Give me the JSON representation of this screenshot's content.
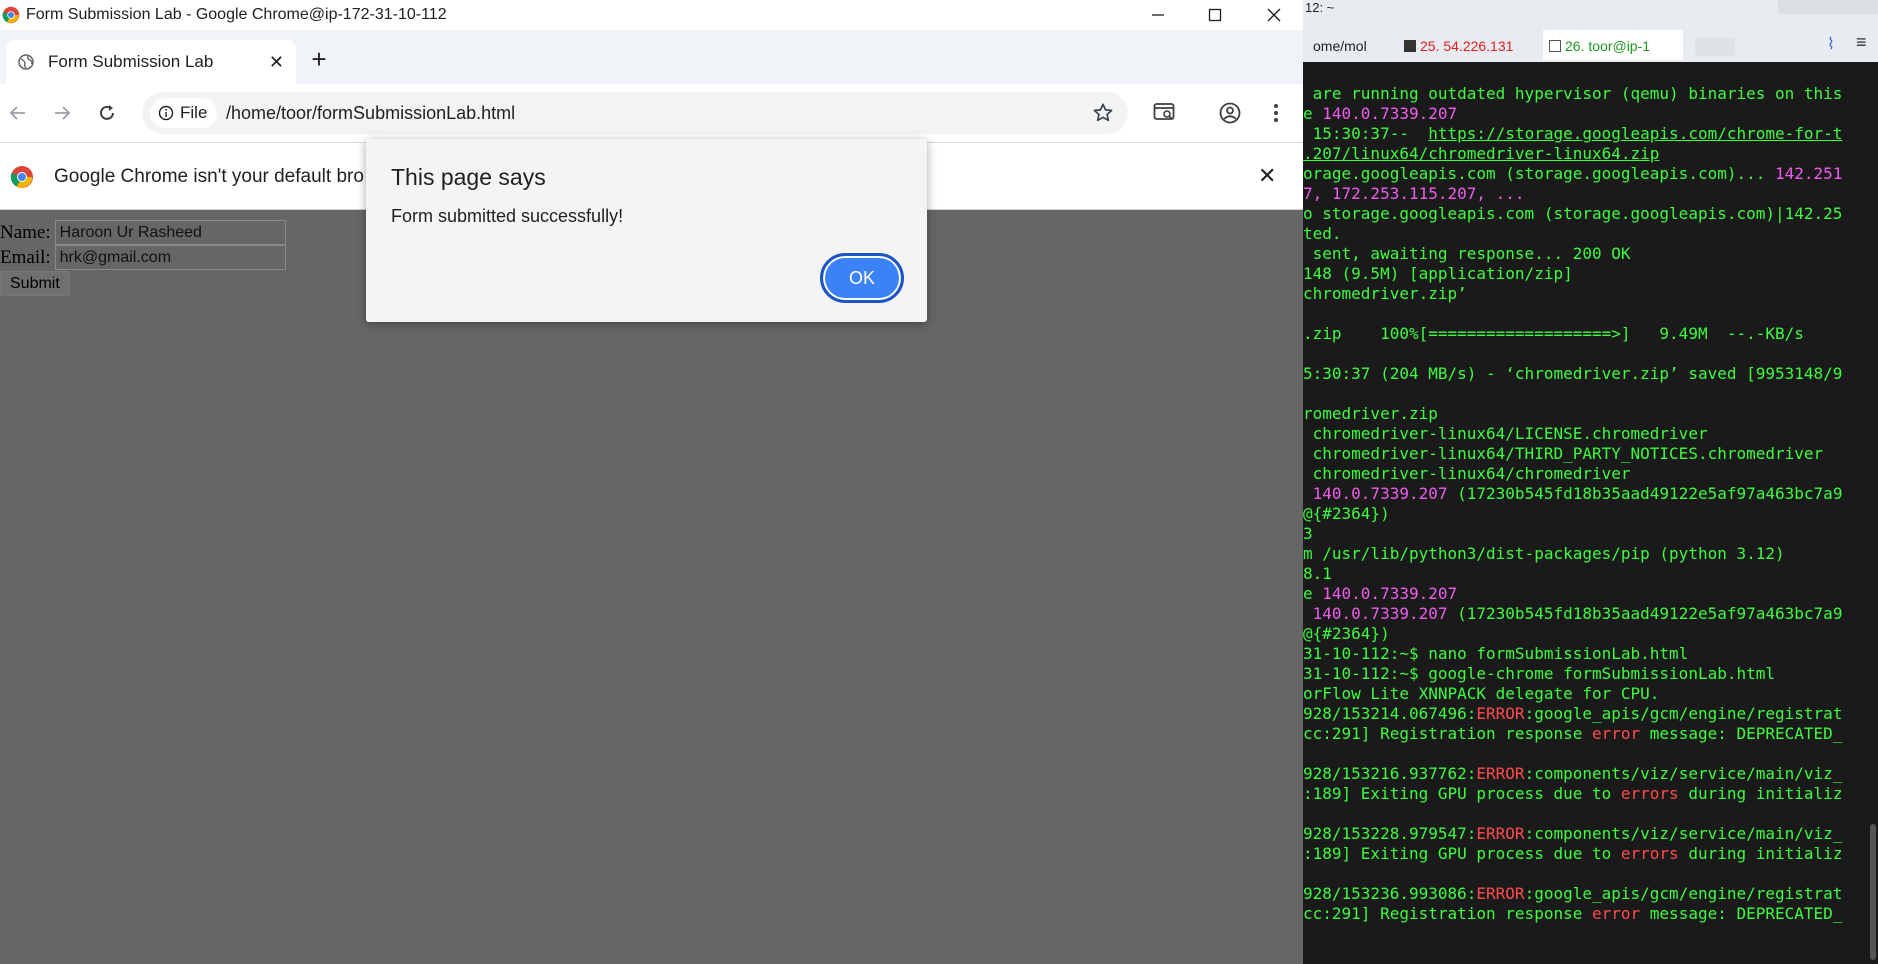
{
  "chrome": {
    "window_title": "Form Submission Lab - Google Chrome@ip-172-31-10-112",
    "tab_title": "Form Submission Lab",
    "new_tab_symbol": "+",
    "site_chip": "File",
    "url": "/home/toor/formSubmissionLab.html",
    "infobar_message": "Google Chrome isn't your default browser",
    "colors": {
      "accent": "#3b82f6",
      "page_overlay": "#666666"
    }
  },
  "page": {
    "name_label": "Name:",
    "name_value": "Haroon Ur Rasheed",
    "email_label": "Email:",
    "email_value": "hrk@gmail.com",
    "submit_label": "Submit"
  },
  "alert": {
    "heading": "This page says",
    "message": "Form submitted successfully!",
    "ok_label": "OK"
  },
  "terminal": {
    "title": "12: ~",
    "tabs": [
      {
        "label": "ome/mol",
        "color": "#222222"
      },
      {
        "label": "25. 54.226.131",
        "color": "#e02020"
      },
      {
        "label": "26. toor@ip-1",
        "color": "#1f9a1f"
      }
    ],
    "lines": [
      [
        {
          "t": " are running outdated hypervisor (qemu) binaries on this"
        }
      ],
      [
        {
          "t": "e "
        },
        {
          "t": "140.0.7339.207",
          "c": "mg"
        }
      ],
      [
        {
          "t": " 15:30:37--  "
        },
        {
          "t": "https://storage.googleapis.com/chrome-for-t",
          "c": "lk"
        }
      ],
      [
        {
          "t": ".207/linux64/chromedriver-linux64.zip",
          "c": "lk"
        }
      ],
      [
        {
          "t": "orage.googleapis.com (storage.googleapis.com)... "
        },
        {
          "t": "142.251",
          "c": "mg"
        }
      ],
      [
        {
          "t": "7, 172.253.115.207, ...",
          "c": "mg"
        }
      ],
      [
        {
          "t": "o storage.googleapis.com (storage.googleapis.com)|142.25"
        }
      ],
      [
        {
          "t": "ted."
        }
      ],
      [
        {
          "t": " sent, awaiting response... 200 OK"
        }
      ],
      [
        {
          "t": "148 (9.5M) [application/zip]"
        }
      ],
      [
        {
          "t": "chromedriver.zip’"
        }
      ],
      [
        {
          "t": ""
        }
      ],
      [
        {
          "t": ".zip    100%[===================>]   9.49M  --.-KB/s"
        }
      ],
      [
        {
          "t": ""
        }
      ],
      [
        {
          "t": "5:30:37 (204 MB/s) - ‘chromedriver.zip’ saved [9953148/9"
        }
      ],
      [
        {
          "t": ""
        }
      ],
      [
        {
          "t": "romedriver.zip"
        }
      ],
      [
        {
          "t": " chromedriver-linux64/LICENSE.chromedriver"
        }
      ],
      [
        {
          "t": " chromedriver-linux64/THIRD_PARTY_NOTICES.chromedriver"
        }
      ],
      [
        {
          "t": " chromedriver-linux64/chromedriver"
        }
      ],
      [
        {
          "t": " 140.0.7339.207",
          "c": "mg"
        },
        {
          "t": " (17230b545fd18b35aad49122e5af97a463bc7a9"
        }
      ],
      [
        {
          "t": "@{#2364})"
        }
      ],
      [
        {
          "t": "3"
        }
      ],
      [
        {
          "t": "m /usr/lib/python3/dist-packages/pip (python 3.12)"
        }
      ],
      [
        {
          "t": "8.1"
        }
      ],
      [
        {
          "t": "e "
        },
        {
          "t": "140.0.7339.207",
          "c": "mg"
        }
      ],
      [
        {
          "t": " 140.0.7339.207",
          "c": "mg"
        },
        {
          "t": " (17230b545fd18b35aad49122e5af97a463bc7a9"
        }
      ],
      [
        {
          "t": "@{#2364})"
        }
      ],
      [
        {
          "t": "31-10-112:~$ nano formSubmissionLab.html"
        }
      ],
      [
        {
          "t": "31-10-112:~$ google-chrome formSubmissionLab.html"
        }
      ],
      [
        {
          "t": "orFlow Lite XNNPACK delegate for CPU."
        }
      ],
      [
        {
          "t": "928/153214.067496:"
        },
        {
          "t": "ERROR",
          "c": "rd"
        },
        {
          "t": ":google_apis/gcm/engine/registrat"
        }
      ],
      [
        {
          "t": "cc:291] Registration response "
        },
        {
          "t": "error",
          "c": "rd"
        },
        {
          "t": " message: DEPRECATED_"
        }
      ],
      [
        {
          "t": ""
        }
      ],
      [
        {
          "t": "928/153216.937762:"
        },
        {
          "t": "ERROR",
          "c": "rd"
        },
        {
          "t": ":components/viz/service/main/viz_"
        }
      ],
      [
        {
          "t": ":189] Exiting GPU process due to "
        },
        {
          "t": "errors",
          "c": "rd"
        },
        {
          "t": " during initializ"
        }
      ],
      [
        {
          "t": ""
        }
      ],
      [
        {
          "t": "928/153228.979547:"
        },
        {
          "t": "ERROR",
          "c": "rd"
        },
        {
          "t": ":components/viz/service/main/viz_"
        }
      ],
      [
        {
          "t": ":189] Exiting GPU process due to "
        },
        {
          "t": "errors",
          "c": "rd"
        },
        {
          "t": " during initializ"
        }
      ],
      [
        {
          "t": ""
        }
      ],
      [
        {
          "t": "928/153236.993086:"
        },
        {
          "t": "ERROR",
          "c": "rd"
        },
        {
          "t": ":google_apis/gcm/engine/registrat"
        }
      ],
      [
        {
          "t": "cc:291] Registration response "
        },
        {
          "t": "error",
          "c": "rd"
        },
        {
          "t": " message: DEPRECATED_"
        }
      ]
    ]
  }
}
